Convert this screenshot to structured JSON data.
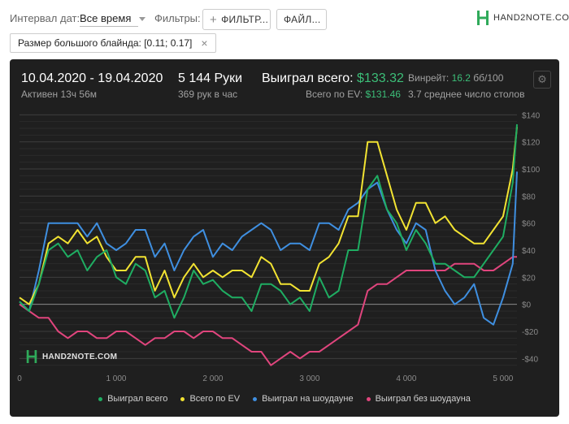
{
  "topbar": {
    "date_interval_label": "Интервал дат:",
    "date_interval_value": "Все время",
    "filters_label": "Фильтры:",
    "filter_button": "ФИЛЬТР...",
    "file_button": "ФАЙЛ...",
    "brand": "HAND2NOTE.COM"
  },
  "active_filter": {
    "label": "Размер большого блайнда: [0.11; 0.17]"
  },
  "stats": {
    "date_range": "10.04.2020 - 19.04.2020",
    "active_time": "Активен 13ч 56м",
    "hands": "5 144 Руки",
    "hands_per_hour": "369 рук в час",
    "won_total_label": "Выиграл всего:",
    "won_total_value": "$133.32",
    "ev_label": "Всего по EV:",
    "ev_value": "$131.46",
    "winrate_label": "Винрейт:",
    "winrate_value": "16.2",
    "winrate_unit": "бб/100",
    "tables": "3.7 среднее число столов"
  },
  "watermark": "HAND2NOTE.COM",
  "colors": {
    "green": "#1fad62",
    "yellow": "#f2e332",
    "blue": "#3f8fe0",
    "pink": "#e0457d",
    "accent": "#3cbe78"
  },
  "chart_data": {
    "type": "line",
    "xlim": [
      0,
      5144
    ],
    "ylim": [
      -50,
      145
    ],
    "x_ticks": [
      0,
      1000,
      2000,
      3000,
      4000,
      5000
    ],
    "x_tick_labels": [
      "0",
      "1 000",
      "2 000",
      "3 000",
      "4 000",
      "5 000"
    ],
    "y_ticks": [
      -40,
      -20,
      0,
      20,
      40,
      60,
      80,
      100,
      120,
      140
    ],
    "y_tick_labels": [
      "-$40",
      "-$20",
      "$0",
      "$20",
      "$40",
      "$60",
      "$80",
      "$100",
      "$120",
      "$140"
    ],
    "grid": true,
    "legend_position": "bottom",
    "x": [
      0,
      100,
      200,
      300,
      400,
      500,
      600,
      700,
      800,
      900,
      1000,
      1100,
      1200,
      1300,
      1400,
      1500,
      1600,
      1700,
      1800,
      1900,
      2000,
      2100,
      2200,
      2300,
      2400,
      2500,
      2600,
      2700,
      2800,
      2900,
      3000,
      3100,
      3200,
      3300,
      3400,
      3500,
      3600,
      3700,
      3800,
      3900,
      4000,
      4100,
      4200,
      4300,
      4400,
      4500,
      4600,
      4700,
      4800,
      4900,
      5000,
      5100,
      5144
    ],
    "series": [
      {
        "name": "Выиграл всего",
        "color": "#1fad62",
        "values": [
          2,
          -5,
          15,
          40,
          45,
          35,
          40,
          25,
          35,
          40,
          20,
          15,
          30,
          25,
          5,
          10,
          -10,
          5,
          25,
          15,
          18,
          10,
          5,
          5,
          -5,
          15,
          15,
          10,
          0,
          5,
          -5,
          20,
          5,
          10,
          40,
          40,
          85,
          95,
          70,
          60,
          40,
          55,
          45,
          30,
          30,
          25,
          20,
          20,
          30,
          40,
          50,
          90,
          133
        ]
      },
      {
        "name": "Всего по EV",
        "color": "#f2e332",
        "values": [
          5,
          0,
          15,
          45,
          50,
          45,
          55,
          45,
          50,
          35,
          25,
          25,
          35,
          35,
          10,
          25,
          5,
          20,
          30,
          20,
          25,
          20,
          25,
          25,
          20,
          35,
          30,
          15,
          15,
          10,
          10,
          30,
          35,
          45,
          65,
          65,
          120,
          120,
          95,
          70,
          55,
          75,
          75,
          60,
          65,
          55,
          50,
          45,
          45,
          55,
          65,
          100,
          131
        ]
      },
      {
        "name": "Выиграл на шоудауне",
        "color": "#3f8fe0",
        "values": [
          2,
          -5,
          25,
          60,
          60,
          60,
          60,
          50,
          60,
          45,
          40,
          45,
          55,
          55,
          35,
          45,
          25,
          40,
          50,
          55,
          35,
          45,
          40,
          50,
          55,
          60,
          55,
          40,
          45,
          45,
          40,
          60,
          60,
          55,
          70,
          75,
          85,
          90,
          70,
          55,
          45,
          60,
          55,
          25,
          10,
          0,
          5,
          15,
          -10,
          -15,
          5,
          30,
          98
        ]
      },
      {
        "name": "Выиграл без шоудауна",
        "color": "#e0457d",
        "values": [
          0,
          -5,
          -10,
          -10,
          -20,
          -25,
          -20,
          -20,
          -25,
          -25,
          -20,
          -20,
          -25,
          -30,
          -25,
          -25,
          -20,
          -20,
          -25,
          -20,
          -20,
          -25,
          -25,
          -30,
          -35,
          -35,
          -45,
          -40,
          -35,
          -40,
          -35,
          -35,
          -30,
          -25,
          -20,
          -15,
          10,
          15,
          15,
          20,
          25,
          25,
          25,
          25,
          25,
          30,
          30,
          30,
          25,
          25,
          30,
          35,
          35
        ]
      }
    ]
  }
}
